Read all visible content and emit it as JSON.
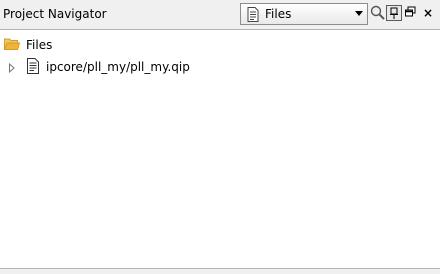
{
  "panel": {
    "title": "Project Navigator",
    "view_selector": {
      "selected": "Files",
      "icon": "document-icon"
    },
    "toolbar": {
      "search_icon": "magnifier",
      "pin_icon": "pin",
      "restore_icon": "restore-window",
      "close_label": "×"
    }
  },
  "tree": {
    "root": {
      "label": "Files",
      "icon": "folder-open-icon"
    },
    "items": [
      {
        "label": "ipcore/pll_my/pll_my.qip",
        "icon": "document-icon",
        "expanded": false
      }
    ]
  },
  "colors": {
    "panel_bg": "#f0f0f0",
    "content_bg": "#ffffff",
    "folder": "#f0b43c",
    "border": "#b4b4b4"
  }
}
